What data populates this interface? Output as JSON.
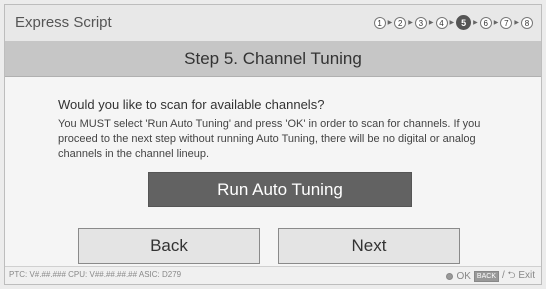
{
  "app": {
    "title": "Express Script"
  },
  "steps": {
    "items": [
      "1",
      "2",
      "3",
      "4",
      "5",
      "6",
      "7",
      "8"
    ],
    "current": 5
  },
  "page": {
    "heading": "Step 5. Channel Tuning"
  },
  "content": {
    "question": "Would you like to scan for available channels?",
    "description": "You MUST select 'Run Auto Tuning' and press 'OK' in order to scan for channels. If you proceed to the next step without running Auto Tuning, there will be no digital or analog channels in the channel lineup."
  },
  "buttons": {
    "run": "Run Auto Tuning",
    "back": "Back",
    "next": "Next"
  },
  "footer": {
    "version_info": "PTC: V#.##.### CPU: V##.##.##.## ASIC: D279",
    "ok_label": "OK",
    "back_key": "BACK",
    "exit_label": "/ ⮌ Exit"
  },
  "colors": {
    "accent": "#626262",
    "active_step": "#555555"
  }
}
